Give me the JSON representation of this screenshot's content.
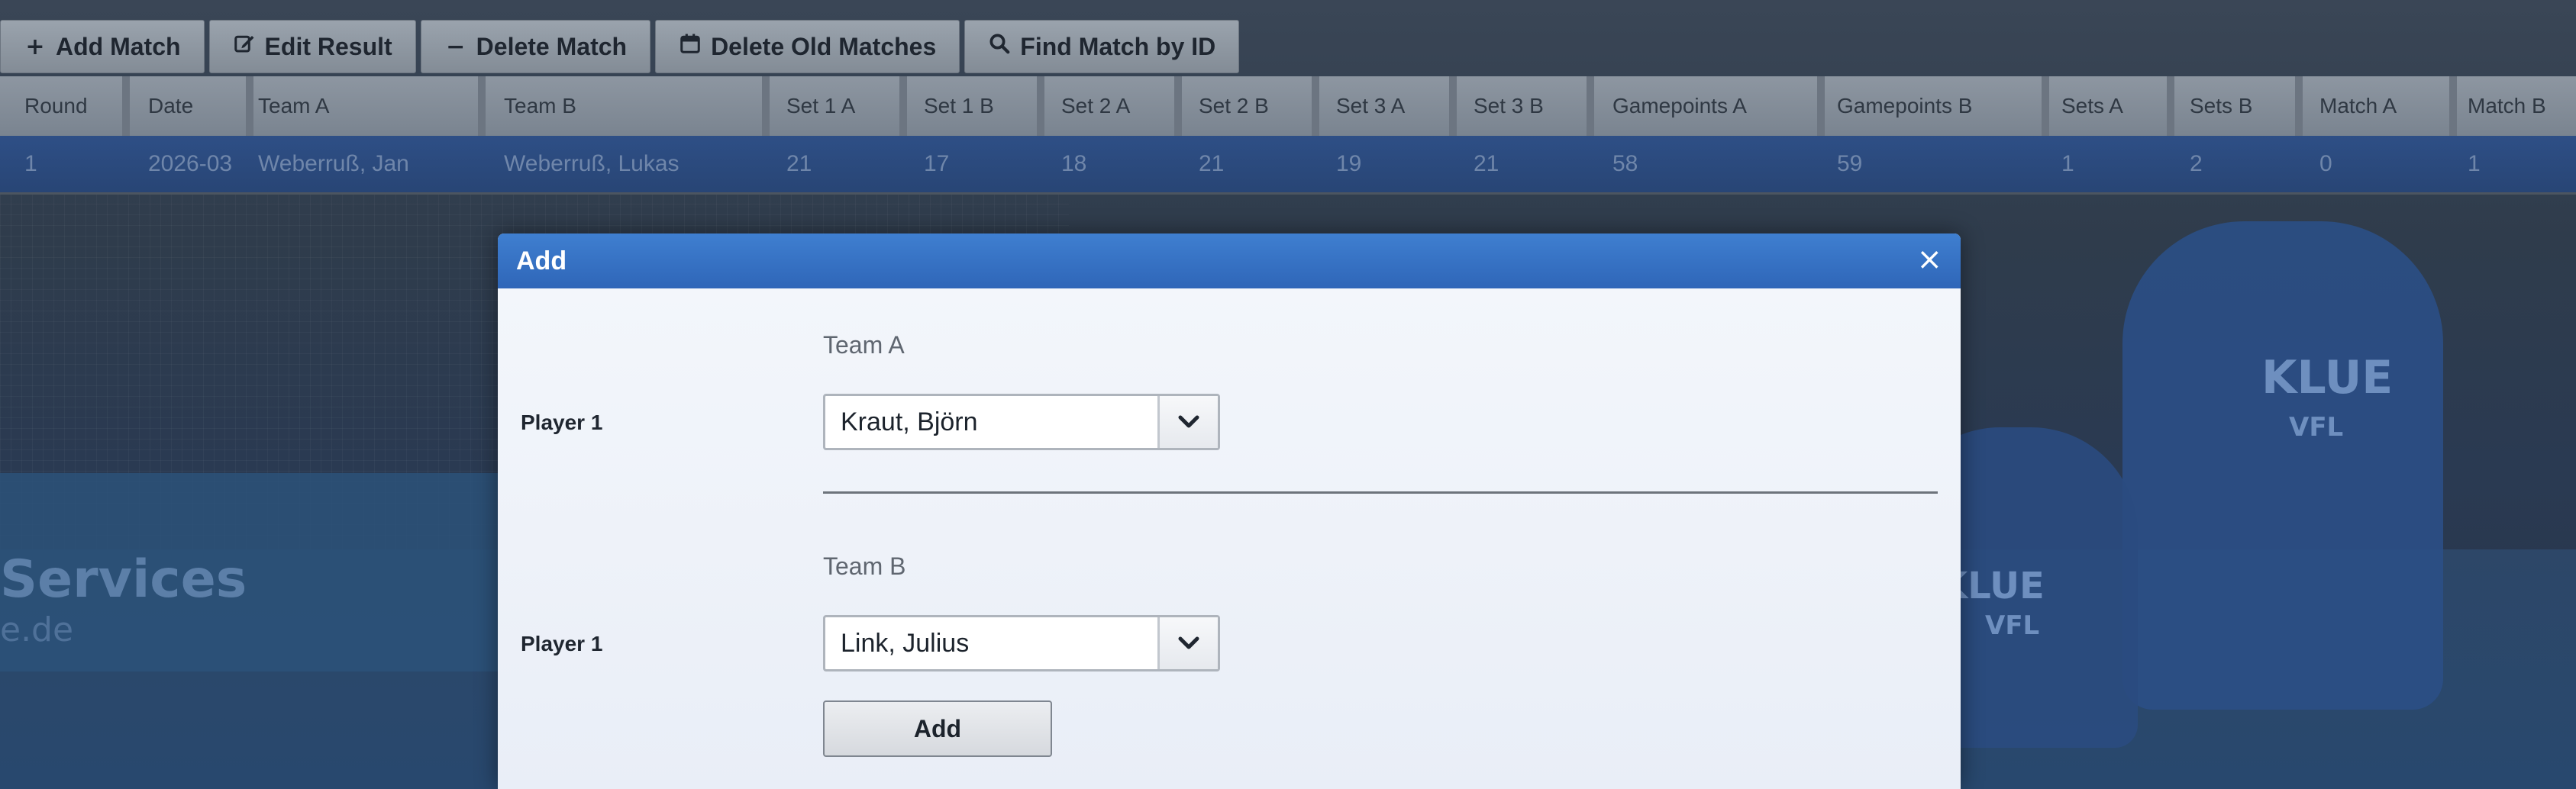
{
  "toolbar": {
    "add_match": "Add Match",
    "edit_result": "Edit Result",
    "delete_match": "Delete Match",
    "delete_old": "Delete Old Matches",
    "find_by_id": "Find Match by ID"
  },
  "grid": {
    "columns": [
      "Round",
      "Date",
      "Team A",
      "Team B",
      "Set 1 A",
      "Set 1 B",
      "Set 2 A",
      "Set 2 B",
      "Set 3 A",
      "Set 3 B",
      "Gamepoints A",
      "Gamepoints B",
      "Sets A",
      "Sets B",
      "Match A",
      "Match B"
    ],
    "rows": [
      [
        "1",
        "2026-03",
        "Weberruß, Jan",
        "Weberruß, Lukas",
        "21",
        "17",
        "18",
        "21",
        "19",
        "21",
        "58",
        "59",
        "1",
        "2",
        "0",
        "1"
      ]
    ]
  },
  "background": {
    "banner_line1": "Services",
    "banner_line2": "e.de",
    "jersey_big": "KLUE",
    "jersey_small": "VFL",
    "jersey_big2": "KLUE",
    "jersey_small2": "VFL"
  },
  "modal": {
    "title": "Add",
    "close": "×",
    "team_a_label": "Team A",
    "team_b_label": "Team B",
    "player_a_label": "Player 1",
    "player_b_label": "Player 1",
    "player_a_value": "Kraut, Björn",
    "player_b_value": "Link, Julius",
    "submit": "Add"
  },
  "colors": {
    "header_blue": "#3f7fd0",
    "selected_row": "#2e4f86"
  }
}
